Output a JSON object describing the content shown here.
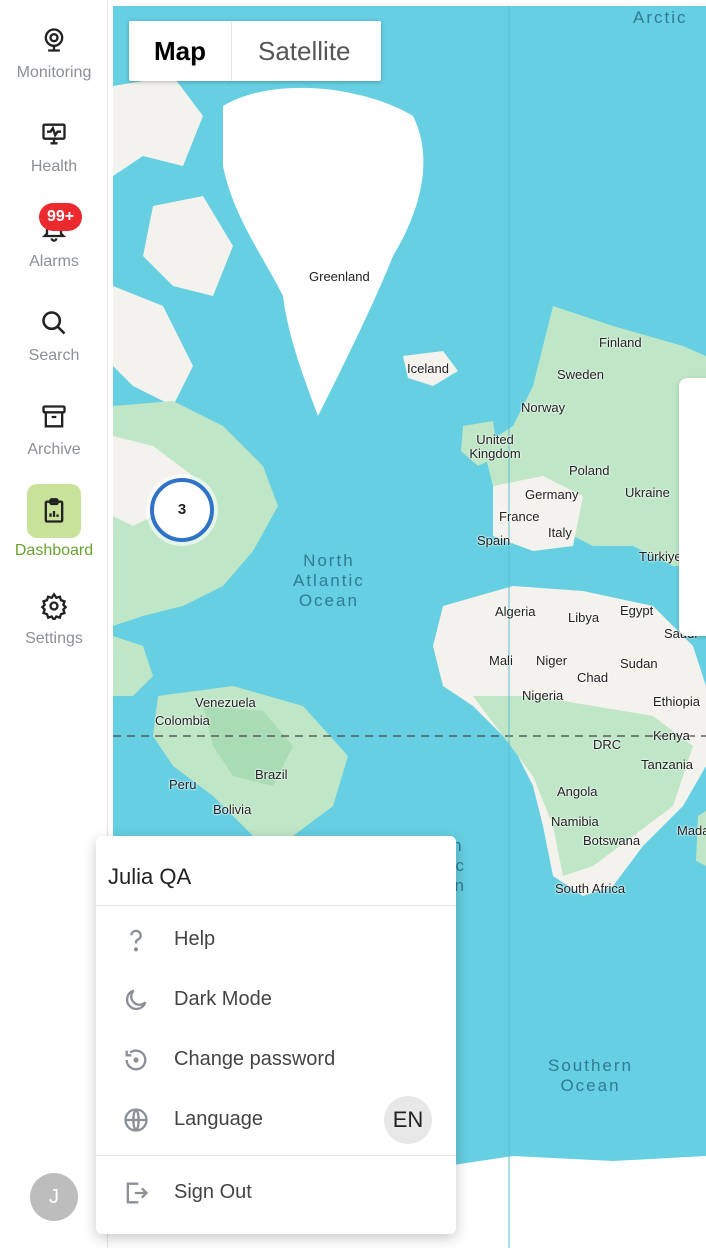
{
  "sidebar": {
    "items": [
      {
        "label": "Monitoring",
        "icon": "webcam-icon"
      },
      {
        "label": "Health",
        "icon": "monitor-heartbeat-icon"
      },
      {
        "label": "Alarms",
        "icon": "bell-icon",
        "badge": "99+"
      },
      {
        "label": "Search",
        "icon": "search-icon"
      },
      {
        "label": "Archive",
        "icon": "archive-box-icon"
      },
      {
        "label": "Dashboard",
        "icon": "clipboard-chart-icon",
        "active": true
      },
      {
        "label": "Settings",
        "icon": "gear-icon"
      }
    ],
    "avatar_initial": "J"
  },
  "map": {
    "toggle": {
      "map_label": "Map",
      "satellite_label": "Satellite",
      "selected": "Map"
    },
    "cluster_count": "3",
    "oceans": {
      "arctic": "Arctic",
      "north_atlantic": "North\nAtlantic\nOcean",
      "south_atlantic_partial": "th\ntic\nan",
      "southern": "Southern\nOcean"
    },
    "labels": [
      "Greenland",
      "Iceland",
      "Finland",
      "Sweden",
      "Norway",
      "United Kingdom",
      "Poland",
      "Germany",
      "Ukraine",
      "France",
      "Italy",
      "Spain",
      "Türkiye",
      "Algeria",
      "Libya",
      "Egypt",
      "Saudi",
      "Mali",
      "Niger",
      "Sudan",
      "Chad",
      "Nigeria",
      "Ethiopia",
      "Kenya",
      "DRC",
      "Tanzania",
      "Angola",
      "Namibia",
      "Botswana",
      "Mada",
      "South Africa",
      "Venezuela",
      "Colombia",
      "Brazil",
      "Peru",
      "Bolivia"
    ],
    "colors": {
      "water": "#66cfe2",
      "land": "#f4f2ec",
      "green": "#bfe6c7",
      "ice": "#ffffff",
      "cluster_ring": "#2f73c8"
    }
  },
  "user_menu": {
    "user_name": "Julia QA",
    "items": {
      "help": "Help",
      "dark_mode": "Dark Mode",
      "change_password": "Change password",
      "language": "Language",
      "language_code": "EN",
      "sign_out": "Sign Out"
    }
  },
  "colors": {
    "accent_green": "#6aa231",
    "active_bg": "#c8e29a",
    "badge_red": "#ea2a2f"
  }
}
